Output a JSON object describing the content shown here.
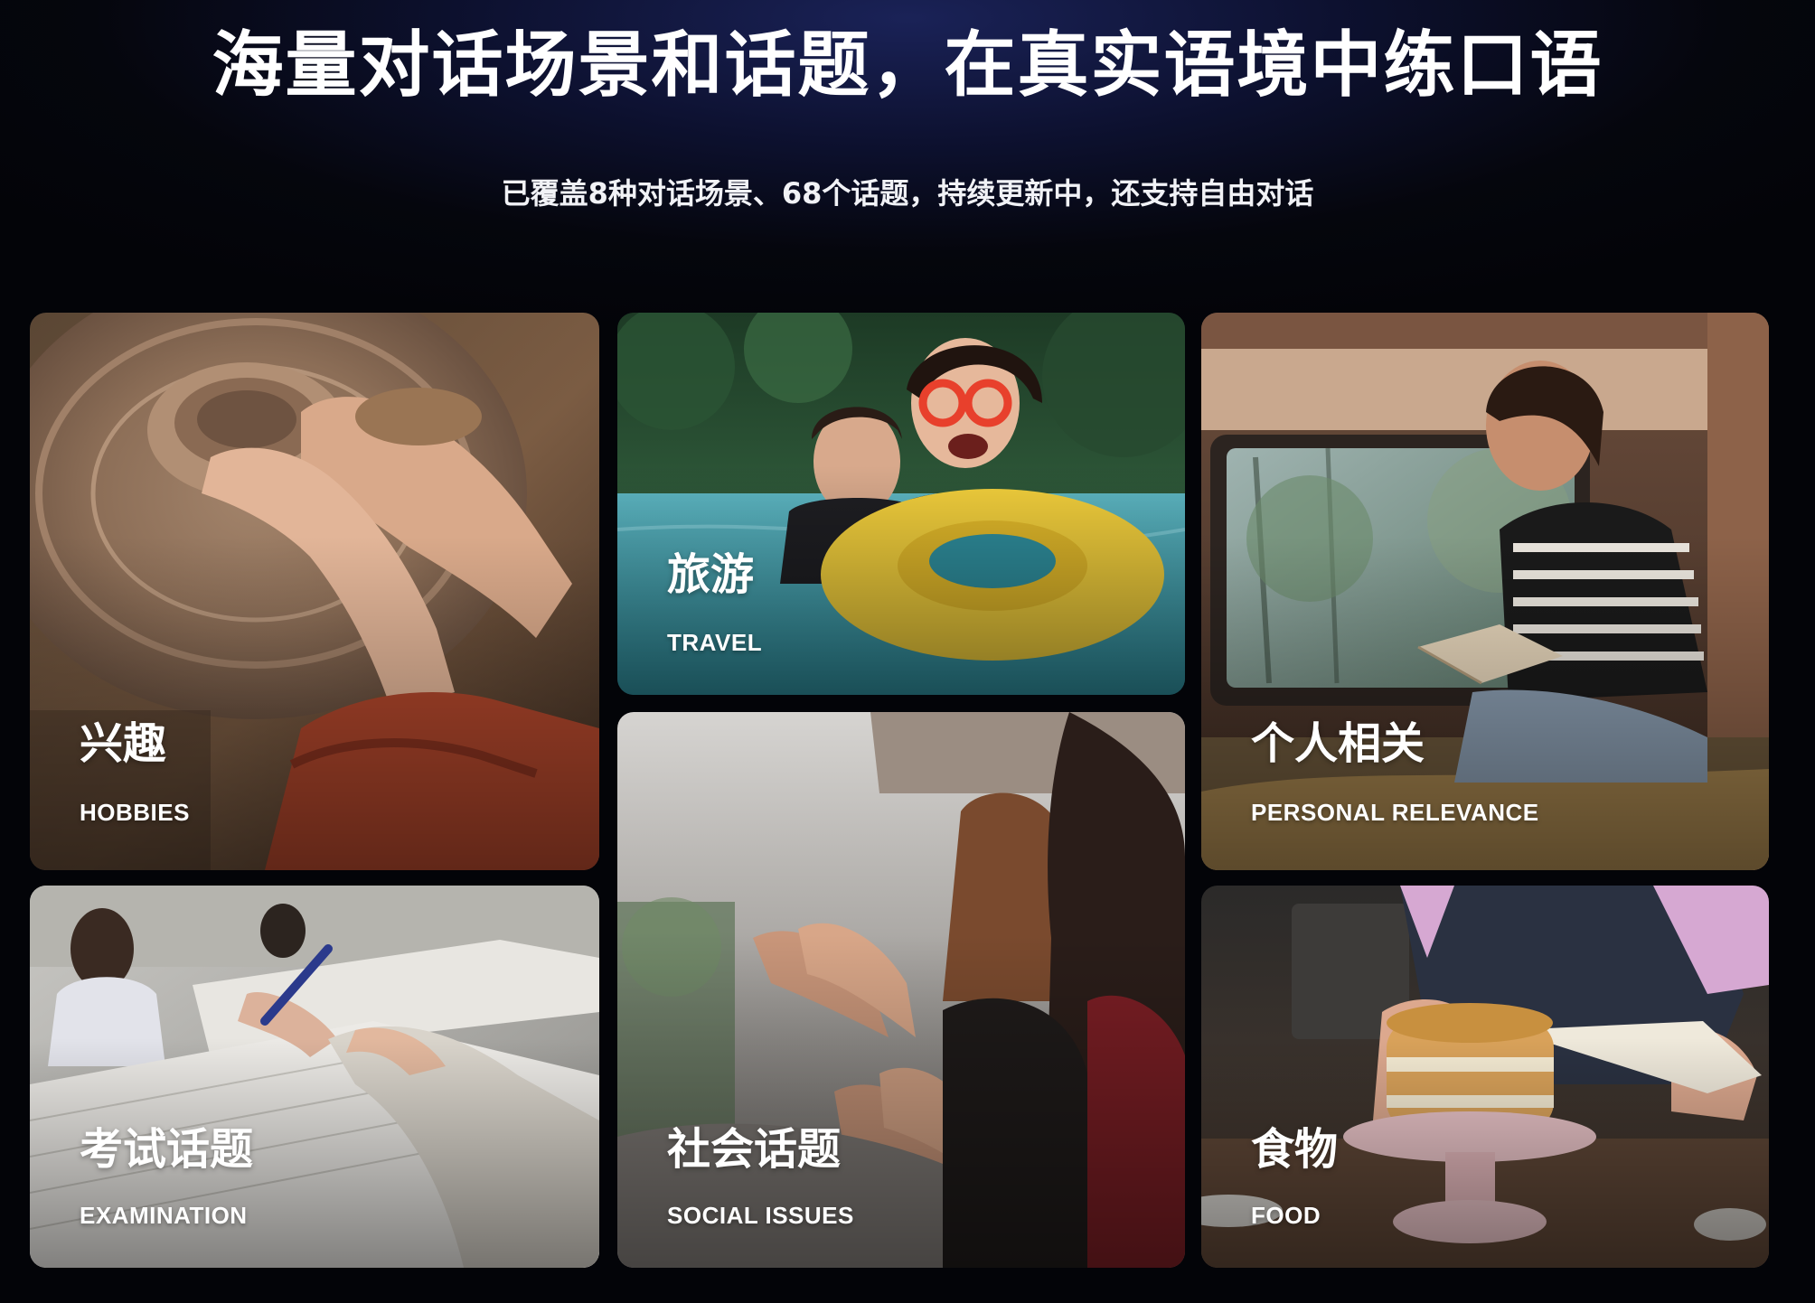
{
  "header": {
    "headline": "海量对话场景和话题，在真实语境中练口语",
    "subline": "已覆盖8种对话场景、68个话题，持续更新中，还支持自由对话"
  },
  "cards": [
    {
      "title": "兴趣",
      "subtitle": "HOBBIES",
      "photo": "pottery-wheel-hands"
    },
    {
      "title": "旅游",
      "subtitle": "TRAVEL",
      "photo": "child-swimming-pool-float"
    },
    {
      "title": "个人相关",
      "subtitle": "PERSONAL RELEVANCE",
      "photo": "woman-reading-in-camper"
    },
    {
      "title": "考试话题",
      "subtitle": "EXAMINATION",
      "photo": "students-writing-exam"
    },
    {
      "title": "社会话题",
      "subtitle": "SOCIAL ISSUES",
      "photo": "people-clapping"
    },
    {
      "title": "食物",
      "subtitle": "FOOD",
      "photo": "decorating-layer-cake"
    }
  ],
  "colors": {
    "background_top": "#1a2257",
    "background_bottom": "#030408",
    "text": "#ffffff"
  }
}
